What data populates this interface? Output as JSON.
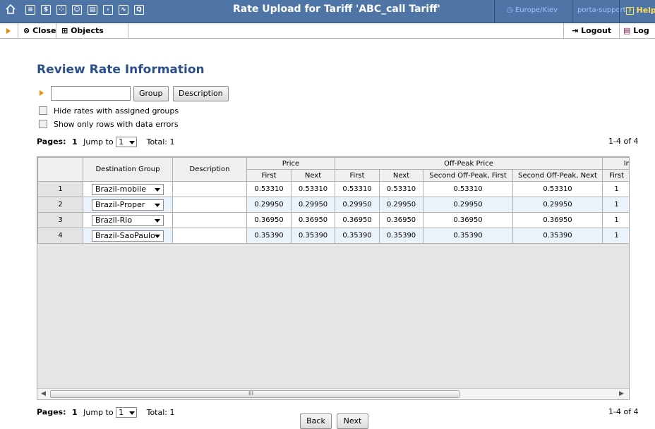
{
  "header": {
    "title": "Rate Upload for Tariff 'ABC_call Tariff'",
    "timezone": "Europe/Kiev",
    "user": "porta-support",
    "help": "Help",
    "icons": [
      "home-icon",
      "list-icon",
      "dollar-icon",
      "grid-icon",
      "person-icon",
      "chart-icon",
      "arrow-icon",
      "graph-icon",
      "search-icon"
    ]
  },
  "toolbar": {
    "close": "Close",
    "objects": "Objects",
    "logout": "Logout",
    "log": "Log"
  },
  "page": {
    "title": "Review Rate Information",
    "search_value": "",
    "group_button": "Group",
    "description_button": "Description",
    "hide_rates_label": "Hide rates with assigned groups",
    "show_errors_label": "Show only rows with data errors"
  },
  "pager": {
    "pages_label": "Pages:",
    "page_number": "1",
    "jump_label": "Jump to",
    "jump_value": "1",
    "total_label": "Total: 1",
    "range": "1-4 of 4"
  },
  "table": {
    "headers": {
      "destination_group": "Destination Group",
      "description": "Description",
      "price": "Price",
      "off_peak_price": "Off-Peak Price",
      "first": "First",
      "next": "Next",
      "second_first": "Second Off-Peak, First",
      "second_next": "Second Off-Peak, Next",
      "cut": "In"
    },
    "rows": [
      {
        "num": "1",
        "group": "Brazil-mobile",
        "description": "",
        "price_first": "0.53310",
        "price_next": "0.53310",
        "op_first": "0.53310",
        "op_next": "0.53310",
        "sop_first": "0.53310",
        "sop_next": "0.53310",
        "int_first": "1"
      },
      {
        "num": "2",
        "group": "Brazil-Proper",
        "description": "",
        "price_first": "0.29950",
        "price_next": "0.29950",
        "op_first": "0.29950",
        "op_next": "0.29950",
        "sop_first": "0.29950",
        "sop_next": "0.29950",
        "int_first": "1"
      },
      {
        "num": "3",
        "group": "Brazil-Rio",
        "description": "",
        "price_first": "0.36950",
        "price_next": "0.36950",
        "op_first": "0.36950",
        "op_next": "0.36950",
        "sop_first": "0.36950",
        "sop_next": "0.36950",
        "int_first": "1"
      },
      {
        "num": "4",
        "group": "Brazil-SaoPaulo",
        "description": "",
        "price_first": "0.35390",
        "price_next": "0.35390",
        "op_first": "0.35390",
        "op_next": "0.35390",
        "sop_first": "0.35390",
        "sop_next": "0.35390",
        "int_first": "1"
      }
    ]
  },
  "footer": {
    "back": "Back",
    "next": "Next"
  },
  "colors": {
    "header_bg": "#4f74a6",
    "title_blue": "#2b4f8a",
    "accent_orange": "#f08a00",
    "alt_row": "#eaf2fb"
  }
}
